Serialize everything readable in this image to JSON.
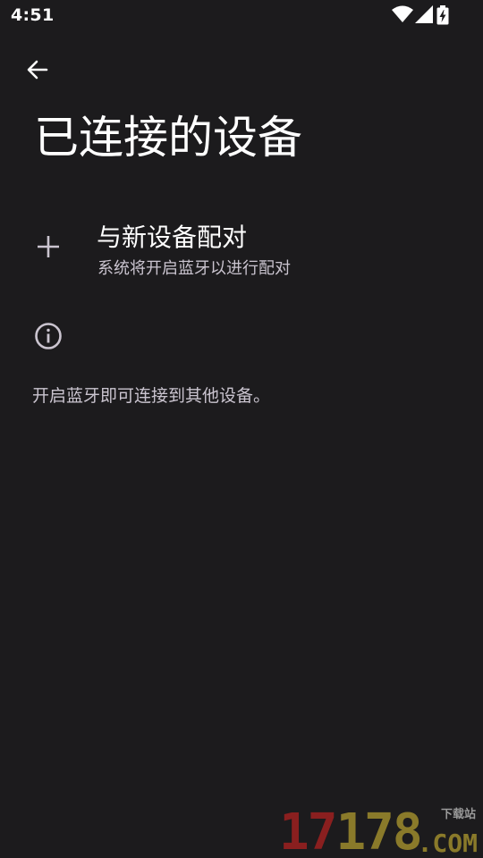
{
  "status_bar": {
    "time": "4:51",
    "icons": [
      "wifi-icon",
      "signal-icon",
      "battery-charging-icon"
    ]
  },
  "header": {
    "back_icon": "arrow-left-icon",
    "title": "已连接的设备"
  },
  "pair_new_device": {
    "icon": "plus-icon",
    "title": "与新设备配对",
    "subtitle": "系统将开启蓝牙以进行配对"
  },
  "info": {
    "icon": "info-icon",
    "text": "开启蓝牙即可连接到其他设备。"
  },
  "watermark": {
    "number_red": "17",
    "number_gold": "178",
    "site_label": "下载站",
    "domain": ".COM"
  },
  "colors": {
    "background": "#1c1b1d",
    "primary_text": "#ffffff",
    "secondary_text": "#cac4cf"
  }
}
